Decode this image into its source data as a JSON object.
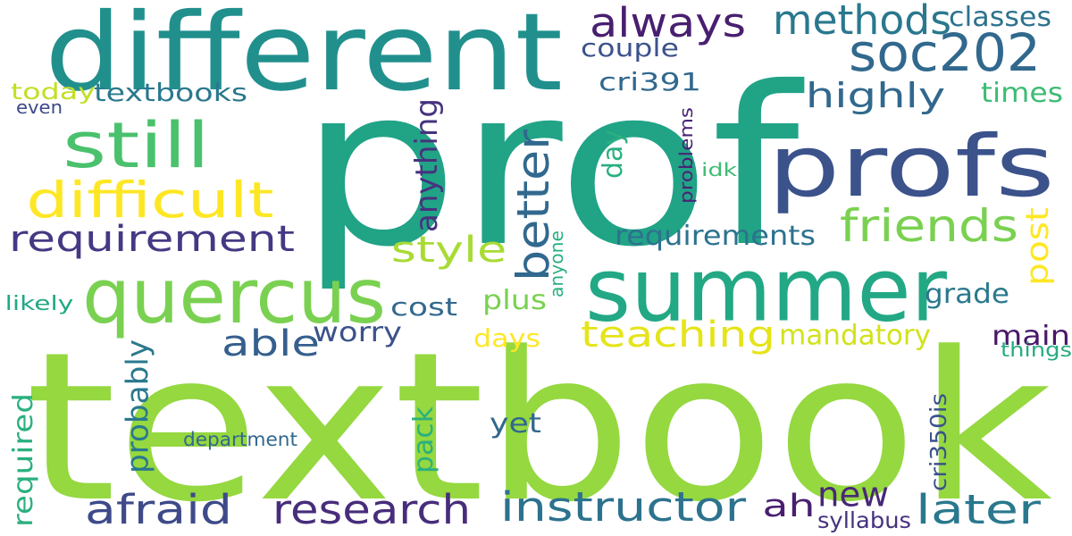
{
  "palette": {
    "yellow": "#fde725",
    "lime": "#a0da39",
    "green": "#4ac16d",
    "teal_green": "#1fa187",
    "teal": "#277f8e",
    "blue": "#365c8d",
    "indigo": "#46327e",
    "purple": "#440154"
  },
  "words": [
    {
      "text": "prof",
      "color": "#21a386",
      "vertical": false
    },
    {
      "text": "textbook",
      "color": "#95d840",
      "vertical": false
    },
    {
      "text": "different",
      "color": "#21908d",
      "vertical": false
    },
    {
      "text": "summer",
      "color": "#22a884",
      "vertical": false
    },
    {
      "text": "profs",
      "color": "#3b528b",
      "vertical": false
    },
    {
      "text": "quercus",
      "color": "#7ad151",
      "vertical": false
    },
    {
      "text": "still",
      "color": "#4ac16d",
      "vertical": false
    },
    {
      "text": "difficult",
      "color": "#fde725",
      "vertical": false
    },
    {
      "text": "requirement",
      "color": "#443983",
      "vertical": false
    },
    {
      "text": "always",
      "color": "#481f70",
      "vertical": false
    },
    {
      "text": "methods",
      "color": "#2a788e",
      "vertical": false
    },
    {
      "text": "soc202",
      "color": "#31688e",
      "vertical": false
    },
    {
      "text": "classes",
      "color": "#2c728e",
      "vertical": false
    },
    {
      "text": "highly",
      "color": "#31688e",
      "vertical": false
    },
    {
      "text": "couple",
      "color": "#3b528b",
      "vertical": false
    },
    {
      "text": "cri391",
      "color": "#31688e",
      "vertical": false
    },
    {
      "text": "times",
      "color": "#3dbc74",
      "vertical": false
    },
    {
      "text": "today",
      "color": "#c2df23",
      "vertical": false
    },
    {
      "text": "textbooks",
      "color": "#2a788e",
      "vertical": false
    },
    {
      "text": "even",
      "color": "#3e4a89",
      "vertical": false
    },
    {
      "text": "friends",
      "color": "#7ad151",
      "vertical": false
    },
    {
      "text": "style",
      "color": "#a8db34",
      "vertical": false
    },
    {
      "text": "requirements",
      "color": "#2c728e",
      "vertical": false
    },
    {
      "text": "teaching",
      "color": "#e5e419",
      "vertical": false
    },
    {
      "text": "mandatory",
      "color": "#d2e21b",
      "vertical": false
    },
    {
      "text": "able",
      "color": "#355f8d",
      "vertical": false
    },
    {
      "text": "worry",
      "color": "#3b528b",
      "vertical": false
    },
    {
      "text": "cost",
      "color": "#31688e",
      "vertical": false
    },
    {
      "text": "plus",
      "color": "#7ad151",
      "vertical": false
    },
    {
      "text": "days",
      "color": "#fde725",
      "vertical": false
    },
    {
      "text": "grade",
      "color": "#2a788e",
      "vertical": false
    },
    {
      "text": "main",
      "color": "#481769",
      "vertical": false
    },
    {
      "text": "things",
      "color": "#25ac82",
      "vertical": false
    },
    {
      "text": "likely",
      "color": "#22a884",
      "vertical": false
    },
    {
      "text": "idk",
      "color": "#3dbc74",
      "vertical": false
    },
    {
      "text": "department",
      "color": "#31688e",
      "vertical": false
    },
    {
      "text": "yet",
      "color": "#31688e",
      "vertical": false
    },
    {
      "text": "afraid",
      "color": "#3e4a89",
      "vertical": false
    },
    {
      "text": "research",
      "color": "#472d7b",
      "vertical": false
    },
    {
      "text": "instructor",
      "color": "#2c728e",
      "vertical": false
    },
    {
      "text": "ah",
      "color": "#481f70",
      "vertical": false
    },
    {
      "text": "new",
      "color": "#482878",
      "vertical": false
    },
    {
      "text": "later",
      "color": "#2a788e",
      "vertical": false
    },
    {
      "text": "syllabus",
      "color": "#46327e",
      "vertical": false
    },
    {
      "text": "better",
      "color": "#31688e",
      "vertical": true
    },
    {
      "text": "anything",
      "color": "#46327e",
      "vertical": true
    },
    {
      "text": "day",
      "color": "#2ab07f",
      "vertical": true
    },
    {
      "text": "problems",
      "color": "#482475",
      "vertical": true
    },
    {
      "text": "post",
      "color": "#fde725",
      "vertical": true
    },
    {
      "text": "anyone",
      "color": "#2ab07f",
      "vertical": true
    },
    {
      "text": "probably",
      "color": "#2a788e",
      "vertical": true
    },
    {
      "text": "required",
      "color": "#2ab07f",
      "vertical": true
    },
    {
      "text": "pack",
      "color": "#2ab07f",
      "vertical": true
    },
    {
      "text": "cri350is",
      "color": "#3b528b",
      "vertical": true
    }
  ]
}
